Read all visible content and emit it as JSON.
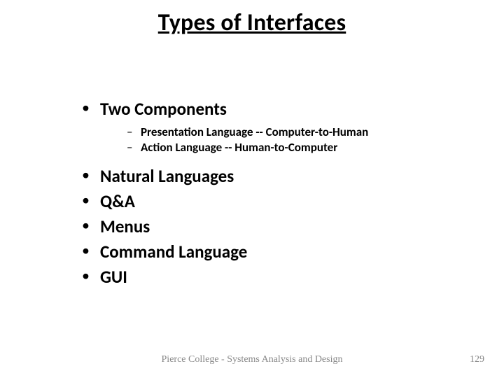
{
  "title": "Types of Interfaces",
  "bullets": [
    {
      "text": "Two Components",
      "children": [
        "Presentation Language -- Computer-to-Human",
        "Action Language -- Human-to-Computer"
      ]
    },
    {
      "text": "Natural Languages"
    },
    {
      "text": "Q&A"
    },
    {
      "text": "Menus"
    },
    {
      "text": "Command Language"
    },
    {
      "text": "GUI"
    }
  ],
  "footer": "Pierce College - Systems Analysis and Design",
  "page_number": "129"
}
